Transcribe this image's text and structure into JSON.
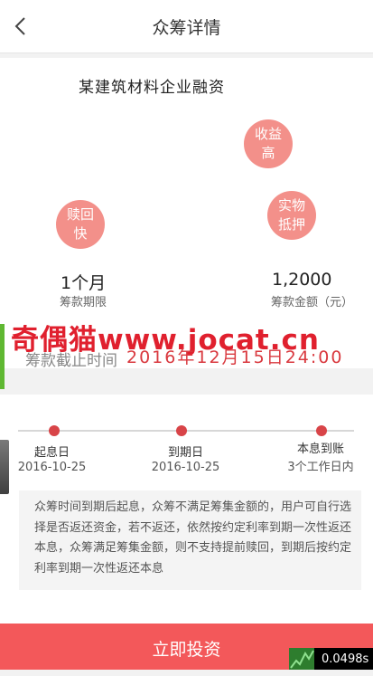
{
  "header": {
    "title": "众筹详情"
  },
  "project": {
    "title": "某建筑材料企业融资",
    "tags": [
      "收益高",
      "赎回快",
      "实物抵押"
    ]
  },
  "stats": {
    "period_value": "1个月",
    "period_label": "筹款期限",
    "amount_value": "1,2000",
    "amount_label": "筹款金额（元）"
  },
  "watermark": "奇偶猫www.jocat.cn",
  "deadline": {
    "label": "筹款截止时间",
    "value": "2016年12月15日24:00"
  },
  "timeline": [
    {
      "label": "起息日",
      "date": "2016-10-25"
    },
    {
      "label": "到期日",
      "date": "2016-10-25"
    },
    {
      "label": "本息到账",
      "date": "3个工作日内"
    }
  ],
  "note": "众筹时间到期后起息，众筹不满足筹集金额的，用户可自行选择是否返还资金，若不返还，依然按约定利率到期一次性返还本息，众筹满足筹集金额，则不支持提前赎回，到期后按约定利率到期一次性返还本息",
  "actions": {
    "invest_label": "立即投资"
  },
  "perf": {
    "time": "0.0498s"
  },
  "colors": {
    "accent": "#f3585a",
    "bubble": "#f3908a",
    "deadline": "#d9393f",
    "watermark": "#e0202e"
  }
}
